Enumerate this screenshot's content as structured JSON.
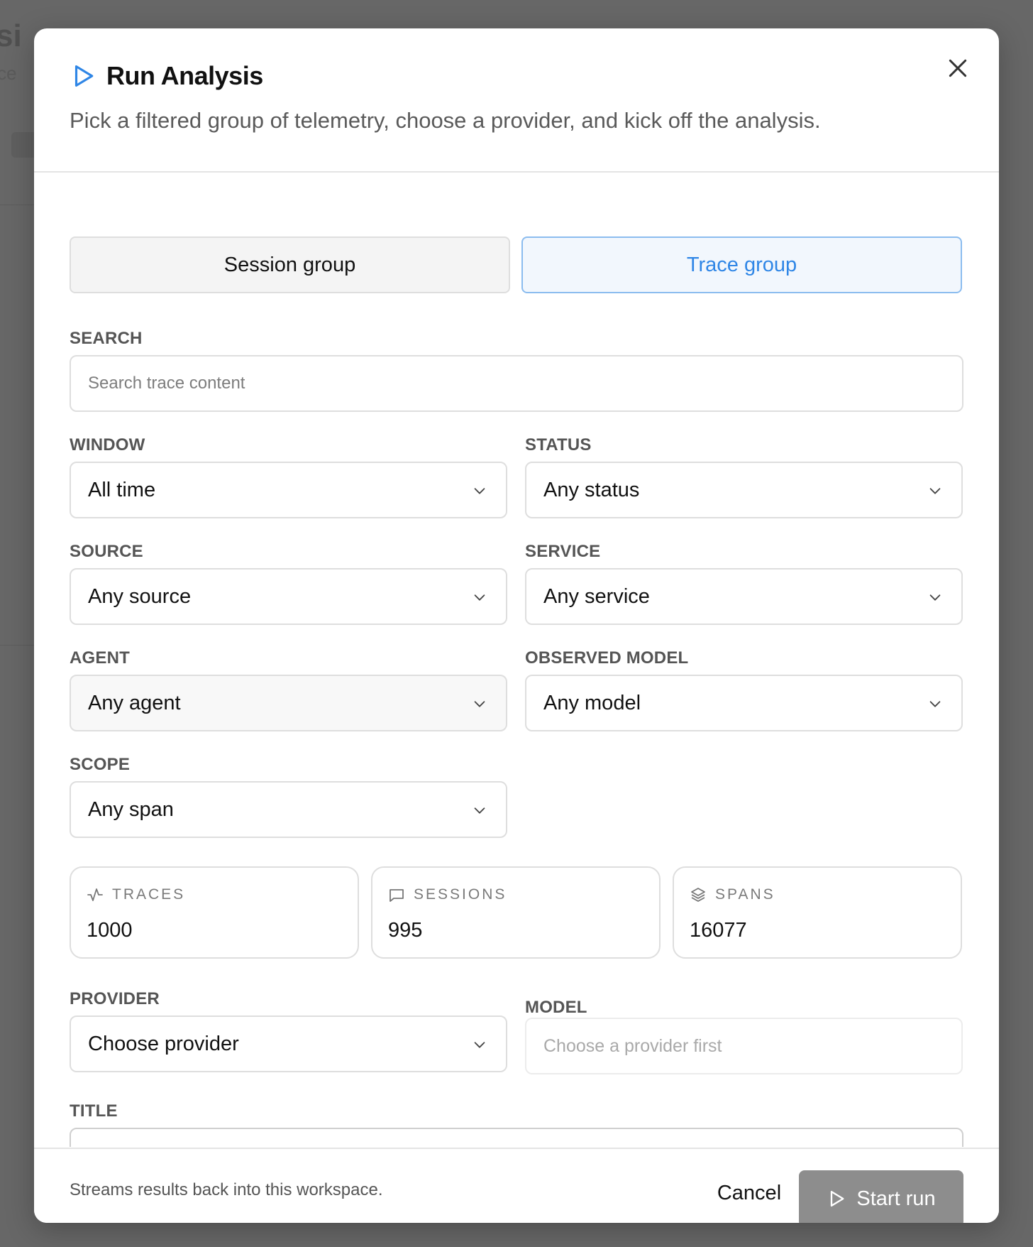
{
  "background": {
    "title_fragment": "si",
    "sub_fragment": "ce"
  },
  "dialog": {
    "title": "Run Analysis",
    "subtitle": "Pick a filtered group of telemetry, choose a provider, and kick off the analysis.",
    "close_icon": "close-icon",
    "title_icon": "play-icon",
    "accent_color": "#2f86e6"
  },
  "tabs": [
    {
      "label": "Session group",
      "active": false
    },
    {
      "label": "Trace group",
      "active": true
    }
  ],
  "search": {
    "label": "SEARCH",
    "placeholder": "Search trace content",
    "value": ""
  },
  "filters": {
    "window": {
      "label": "WINDOW",
      "value": "All time"
    },
    "status": {
      "label": "STATUS",
      "value": "Any status"
    },
    "source": {
      "label": "SOURCE",
      "value": "Any source"
    },
    "service": {
      "label": "SERVICE",
      "value": "Any service"
    },
    "agent": {
      "label": "AGENT",
      "value": "Any agent"
    },
    "observed_model": {
      "label": "OBSERVED MODEL",
      "value": "Any model"
    },
    "scope": {
      "label": "SCOPE",
      "value": "Any span"
    }
  },
  "stats": [
    {
      "label": "TRACES",
      "value": "1000",
      "icon": "activity-icon"
    },
    {
      "label": "SESSIONS",
      "value": "995",
      "icon": "message-square-icon"
    },
    {
      "label": "SPANS",
      "value": "16077",
      "icon": "layers-icon"
    }
  ],
  "provider": {
    "label": "PROVIDER",
    "value": "Choose provider"
  },
  "model": {
    "label": "MODEL",
    "placeholder": "Choose a provider first"
  },
  "title_field": {
    "label": "TITLE"
  },
  "footer": {
    "note": "Streams results back into this workspace.",
    "cancel_label": "Cancel",
    "start_label": "Start run",
    "start_color": "#8d8d8d"
  }
}
